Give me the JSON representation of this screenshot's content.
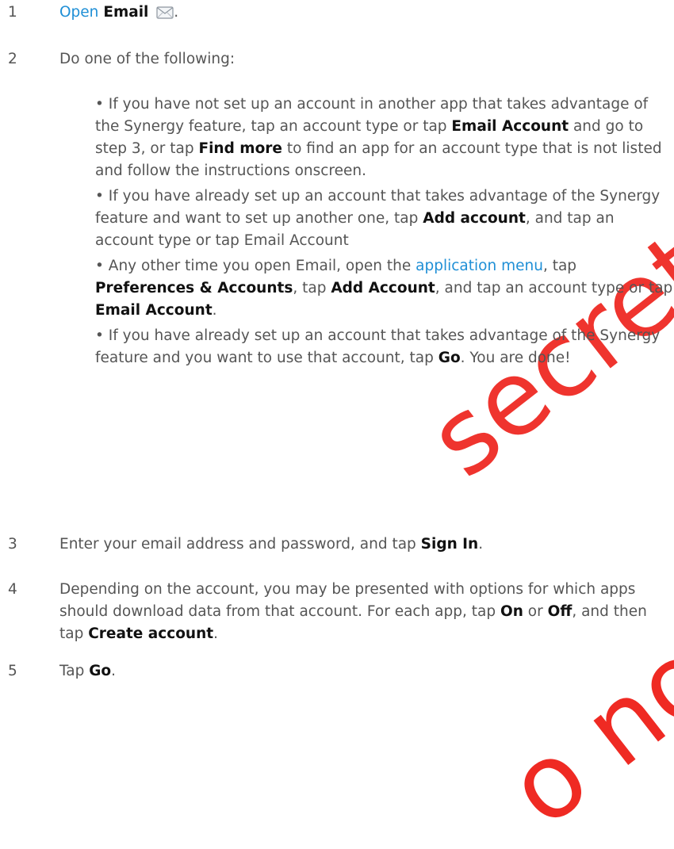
{
  "watermark": {
    "line1": "secret. HP",
    "line2": "o not"
  },
  "step1": {
    "number": "1",
    "open": "Open",
    "email_bold": "Email",
    "end": "."
  },
  "step2": {
    "number": "2",
    "intro": "Do one of the following:",
    "bullet1": {
      "a": "If you have not set up an account in another app that takes advantage of the Synergy feature, tap an account type or tap ",
      "b1": "Email Account",
      "c": " and go to step 3, or tap ",
      "b2": "Find more",
      "d": " to find an app for an account type that is not listed and follow the instructions onscreen."
    },
    "bullet2": {
      "a": "If you have already set up an account that takes advantage of the Synergy feature and want to set up another one, tap ",
      "b1": "Add account",
      "c": ", and tap an account type or tap Email Account"
    },
    "bullet3": {
      "a": "Any other time you open Email, open the ",
      "link": "application menu",
      "b": ", tap ",
      "b1": "Preferences & Accounts",
      "c": ", tap ",
      "b2": "Add Account",
      "d": ", and tap an account type or tap ",
      "b3": "Email Account",
      "e": "."
    },
    "bullet4": {
      "a": "If you have already set up an account that takes advantage of the Synergy feature and you want to use that account, tap ",
      "b1": "Go",
      "c": ". You are done!"
    }
  },
  "step3": {
    "number": "3",
    "a": "Enter your email address and password, and tap ",
    "b1": "Sign In",
    "c": "."
  },
  "step4": {
    "number": "4",
    "a": "Depending on the account, you may be presented with options for which apps should download data from that account. For each app, tap ",
    "b1": "On",
    "b": " or ",
    "b2": "Off",
    "c": ", and then tap ",
    "b3": "Create account",
    "d": "."
  },
  "step5": {
    "number": "5",
    "a": "Tap ",
    "b1": "Go",
    "c": "."
  },
  "icons": {
    "email": "envelope-icon"
  },
  "colors": {
    "link": "#1f8fd6",
    "watermark": "#ef2a23"
  }
}
